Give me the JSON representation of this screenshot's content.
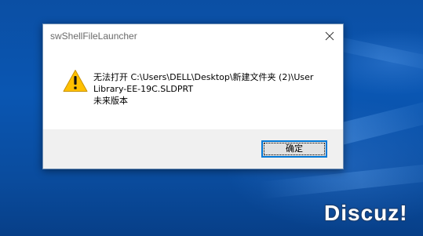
{
  "desktop": {
    "watermark": "Discuz!"
  },
  "dialog": {
    "title": "swShellFileLauncher",
    "message_lines": [
      "无法打开  C:\\Users\\DELL\\Desktop\\新建文件夹 (2)\\User",
      "Library-EE-19C.SLDPRT",
      "未来版本"
    ],
    "ok_label": "确定"
  },
  "icons": {
    "warning": "warning-icon",
    "close": "close-icon"
  },
  "colors": {
    "desktop_blue": "#0a56b2",
    "warning_yellow": "#ffc000",
    "button_focus": "#0078d7",
    "footer_gray": "#f0f0f0"
  }
}
